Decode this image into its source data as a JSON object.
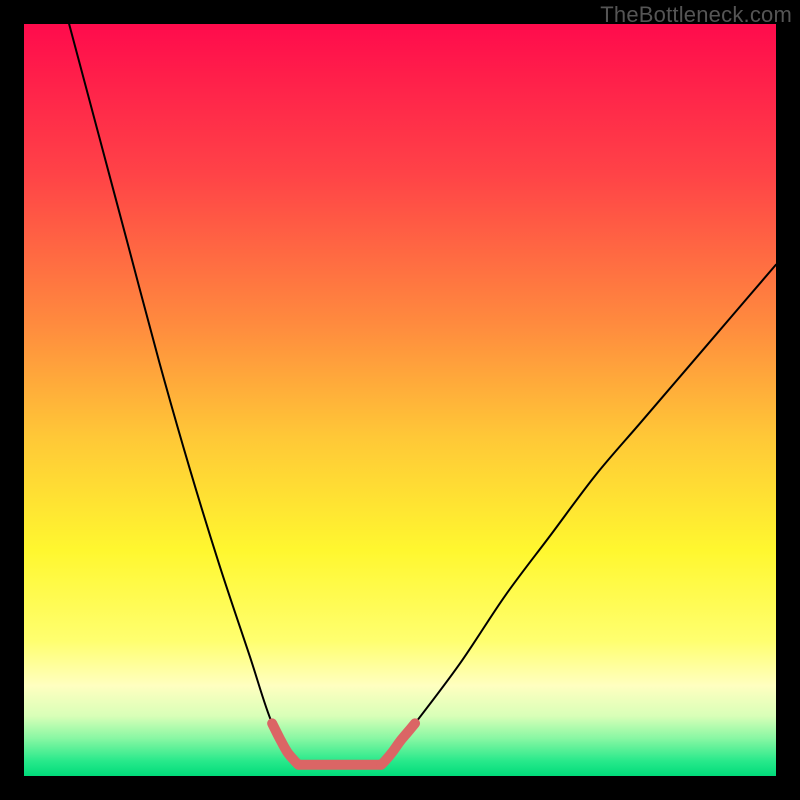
{
  "watermark": "TheBottleneck.com",
  "chart_data": {
    "type": "line",
    "title": "",
    "xlabel": "",
    "ylabel": "",
    "xlim": [
      0,
      100
    ],
    "ylim": [
      0,
      100
    ],
    "grid": false,
    "series": [
      {
        "name": "left-curve",
        "x": [
          6,
          10,
          14,
          18,
          22,
          26,
          30,
          33,
          36
        ],
        "values": [
          100,
          85,
          70,
          55,
          41,
          28,
          16,
          7,
          2
        ],
        "color": "#000000",
        "width": 2
      },
      {
        "name": "right-curve",
        "x": [
          48,
          52,
          58,
          64,
          70,
          76,
          82,
          88,
          94,
          100
        ],
        "values": [
          2,
          7,
          15,
          24,
          32,
          40,
          47,
          54,
          61,
          68
        ],
        "color": "#000000",
        "width": 2
      },
      {
        "name": "red-lobe-left",
        "x": [
          33,
          34,
          35,
          36,
          36.5
        ],
        "values": [
          7,
          5,
          3.2,
          2,
          1.5
        ],
        "color": "#db6565",
        "width": 10
      },
      {
        "name": "red-flat",
        "x": [
          36.5,
          39,
          42,
          45,
          47.5
        ],
        "values": [
          1.5,
          1.5,
          1.5,
          1.5,
          1.5
        ],
        "color": "#db6565",
        "width": 10
      },
      {
        "name": "red-lobe-right",
        "x": [
          47.5,
          48,
          49,
          50,
          51,
          52
        ],
        "values": [
          1.5,
          2,
          3.2,
          4.6,
          5.8,
          7
        ],
        "color": "#db6565",
        "width": 10
      }
    ],
    "background_gradient": {
      "type": "vertical",
      "stops": [
        {
          "pos": 0.0,
          "color": "#ff0b4c"
        },
        {
          "pos": 0.2,
          "color": "#ff4347"
        },
        {
          "pos": 0.4,
          "color": "#ff8b3e"
        },
        {
          "pos": 0.55,
          "color": "#ffc837"
        },
        {
          "pos": 0.7,
          "color": "#fff72f"
        },
        {
          "pos": 0.82,
          "color": "#ffff6f"
        },
        {
          "pos": 0.88,
          "color": "#ffffc0"
        },
        {
          "pos": 0.92,
          "color": "#d9ffb8"
        },
        {
          "pos": 0.95,
          "color": "#88f7a3"
        },
        {
          "pos": 0.98,
          "color": "#28e98b"
        },
        {
          "pos": 1.0,
          "color": "#00db7a"
        }
      ]
    }
  }
}
